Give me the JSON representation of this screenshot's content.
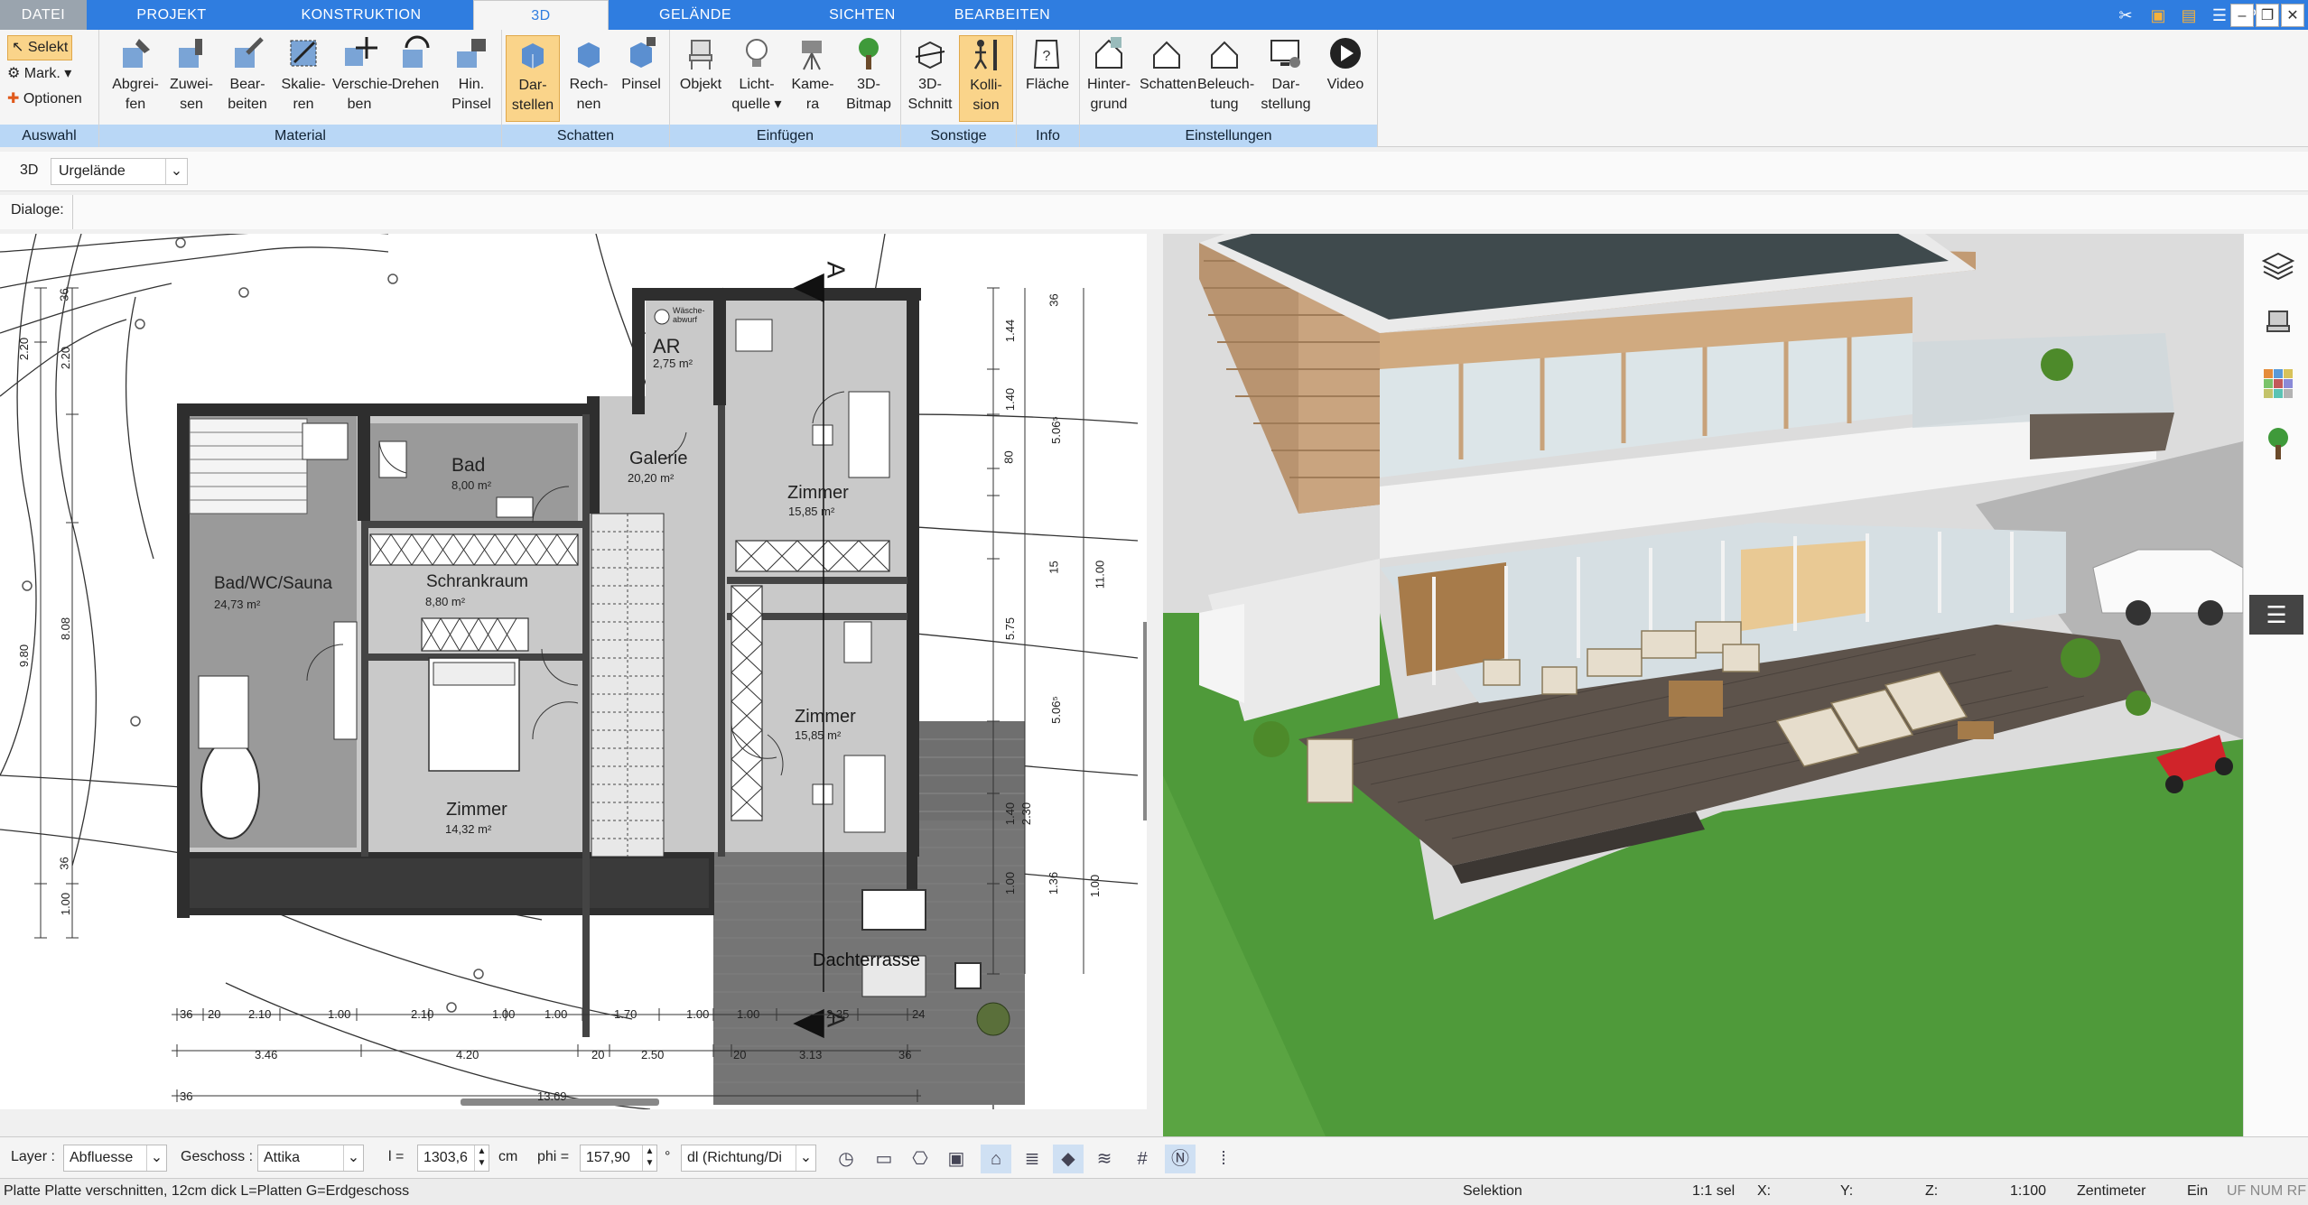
{
  "tabs": [
    {
      "label": "DATEI"
    },
    {
      "label": "PROJEKT"
    },
    {
      "label": "KONSTRUKTION"
    },
    {
      "label": "3D"
    },
    {
      "label": "GELÄNDE"
    },
    {
      "label": "SICHTEN"
    },
    {
      "label": "BEARBEITEN"
    }
  ],
  "auswahl": {
    "select": "Selekt",
    "mark": "Mark.",
    "options": "Optionen",
    "footer": "Auswahl"
  },
  "material": {
    "footer": "Material",
    "buttons": [
      "Abgrei-\nfen",
      "Zuwei-\nsen",
      "Bear-\nbeiten",
      "Skalie-\nren",
      "Verschie-\nben",
      "Drehen",
      "Hin.\nPinsel"
    ]
  },
  "schatten": {
    "footer": "Schatten",
    "buttons": [
      "Dar-\nstellen",
      "Rech-\nnen",
      "Pinsel"
    ]
  },
  "einfuegen": {
    "footer": "Einfügen",
    "buttons": [
      "Objekt",
      "Licht-\nquelle ▾",
      "Kame-\nra",
      "3D-\nBitmap"
    ]
  },
  "sonstige": {
    "footer": "Sonstige",
    "buttons": [
      "3D-\nSchnitt",
      "Kolli-\nsion"
    ]
  },
  "info": {
    "footer": "Info",
    "buttons": [
      "Fläche"
    ]
  },
  "einstellungen": {
    "footer": "Einstellungen",
    "buttons": [
      "Hinter-\ngrund",
      "Schatten",
      "Beleuch-\ntung",
      "Dar-\nstellung",
      "Video"
    ]
  },
  "row3d": {
    "label": "3D",
    "select": "Urgelände"
  },
  "dialoge": {
    "label": "Dialoge:"
  },
  "plan": {
    "rooms": [
      {
        "name": "AR",
        "area": "2,75 m²"
      },
      {
        "name": "Bad",
        "area": "8,00 m²"
      },
      {
        "name": "Galerie",
        "area": "20,20 m²"
      },
      {
        "name": "Zimmer",
        "area": "15,85 m²"
      },
      {
        "name": "Bad/WC/Sauna",
        "area": "24,73 m²"
      },
      {
        "name": "Schrankraum",
        "area": "8,80 m²"
      },
      {
        "name": "Zimmer",
        "area": "15,85 m²"
      },
      {
        "name": "Zimmer",
        "area": "14,32 m²"
      },
      {
        "name": "Dachterrasse",
        "area": ""
      }
    ],
    "laundry": "Wäsche-\nabwurf",
    "section_marks": [
      "A",
      "A"
    ],
    "dims_bottom1": [
      "36",
      "20",
      "2.10",
      "1.00",
      "2.10",
      "1.00",
      "1.00",
      "1.70",
      "1.00",
      "1.00",
      "2.35",
      "24"
    ],
    "dims_bottom2": [
      "3.46",
      "4.20",
      "20",
      "2.50",
      "20",
      "3.13",
      "36"
    ],
    "dims_bottom3": [
      "36",
      "13.69"
    ],
    "dims_left": [
      "36",
      "2.20",
      "2.20",
      "8.08",
      "9.80",
      "36",
      "1.00"
    ],
    "dims_right": [
      "36",
      "1.44",
      "1.40",
      "80",
      "5.06⁵",
      "15",
      "11.00",
      "5.75",
      "5.06⁵",
      "1.40",
      "2.30",
      "1.00",
      "1.36",
      "1.00"
    ]
  },
  "bottom": {
    "layer_label": "Layer :",
    "layer_value": "Abfluesse",
    "geschoss_label": "Geschoss :",
    "geschoss_value": "Attika",
    "l_label": "l =",
    "l_value": "1303,6",
    "l_unit": "cm",
    "phi_label": "phi =",
    "phi_value": "157,90",
    "phi_unit": "°",
    "dl_value": "dl (Richtung/Di"
  },
  "status": {
    "message": "Platte Platte verschnitten, 12cm dick L=Platten G=Erdgeschoss",
    "mode": "Selektion",
    "sel": "1:1 sel",
    "x": "X:",
    "y": "Y:",
    "z": "Z:",
    "scale": "1:100",
    "unit": "Zentimeter",
    "ein": "Ein",
    "flags": "UF NUM RF"
  }
}
